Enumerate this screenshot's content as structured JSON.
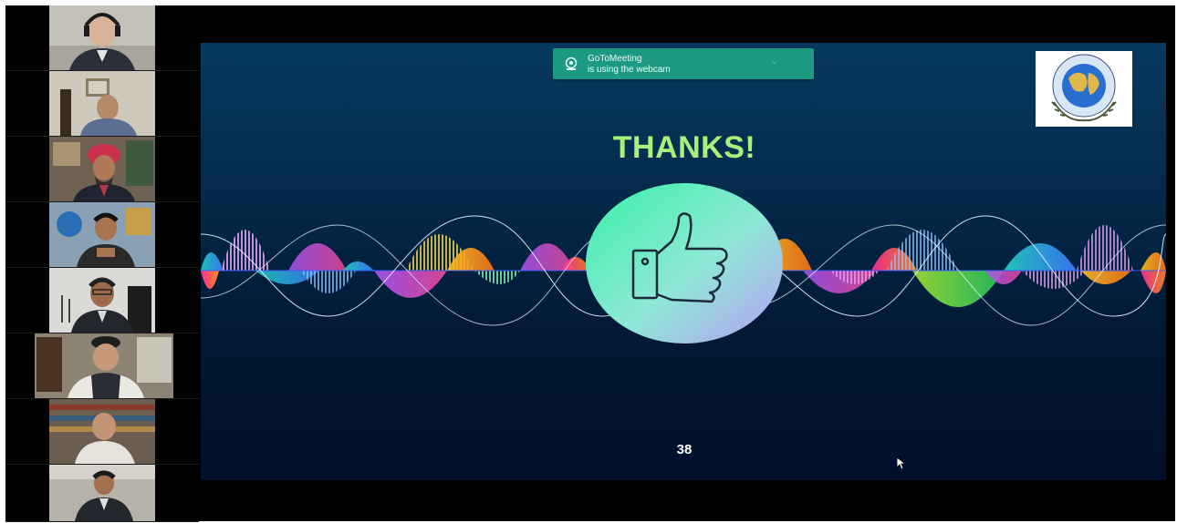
{
  "notification": {
    "title": "GoToMeeting",
    "subtitle": "is using the webcam",
    "icon": "webcam-icon"
  },
  "slide": {
    "title": "THANKS!",
    "page_number": "38",
    "center_icon": "thumbs-up-icon",
    "logo": "globe-emblem-logo",
    "colors": {
      "title": "#a6f07c",
      "background_top": "#073a5e",
      "background_bottom": "#01102a",
      "notification": "#1d9a82"
    }
  },
  "participants": [
    {
      "bg": "#b9b6ad",
      "shirt": "#2c2f3a",
      "skin": "#d8b39a"
    },
    {
      "bg": "#c9c2b6",
      "shirt": "#5c6f93",
      "skin": "#b48a6a"
    },
    {
      "bg": "#7c6c5a",
      "shirt": "#1f2430",
      "skin": "#b07a58"
    },
    {
      "bg": "#9aa7b3",
      "shirt": "#2b2a28",
      "skin": "#a87552"
    },
    {
      "bg": "#d6d3cf",
      "shirt": "#23262c",
      "skin": "#9b6b4c"
    },
    {
      "bg": "#8d8372",
      "shirt": "#ece9e3",
      "skin": "#c79a7c"
    },
    {
      "bg": "#6b5d4f",
      "shirt": "#e6e2dc",
      "skin": "#c49575"
    },
    {
      "bg": "#b7b2aa",
      "shirt": "#23272e",
      "skin": "#a46f4e"
    }
  ]
}
